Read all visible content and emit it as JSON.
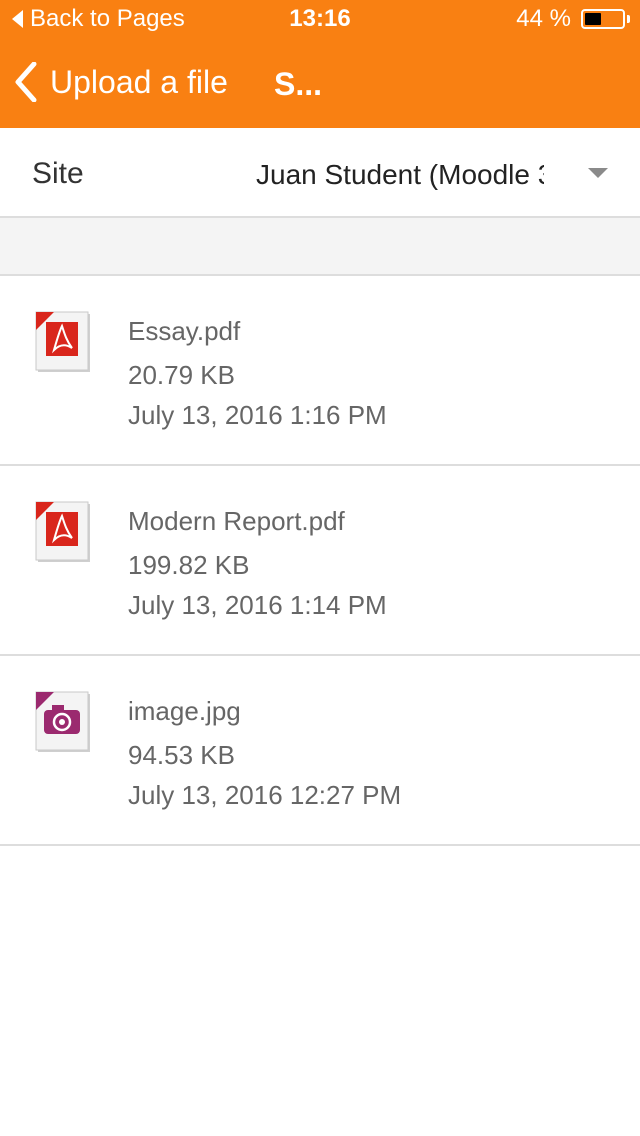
{
  "status_bar": {
    "back_label": "Back to Pages",
    "time": "13:16",
    "battery_percent": "44 %",
    "battery_level": 0.44
  },
  "nav_bar": {
    "back_label": "Upload a file",
    "title": "S..."
  },
  "site": {
    "label": "Site",
    "selected": "Juan Student (Moodle 3"
  },
  "files": [
    {
      "name": "Essay.pdf",
      "size": "20.79 KB",
      "date": "July 13, 2016 1:16 PM",
      "icon": "pdf-file-icon"
    },
    {
      "name": "Modern Report.pdf",
      "size": "199.82 KB",
      "date": "July 13, 2016 1:14 PM",
      "icon": "pdf-file-icon"
    },
    {
      "name": "image.jpg",
      "size": "94.53 KB",
      "date": "July 13, 2016 12:27 PM",
      "icon": "image-file-icon"
    }
  ],
  "colors": {
    "header": "#f98012",
    "pdf_accent": "#d9261c",
    "image_accent": "#9b2a6f"
  }
}
